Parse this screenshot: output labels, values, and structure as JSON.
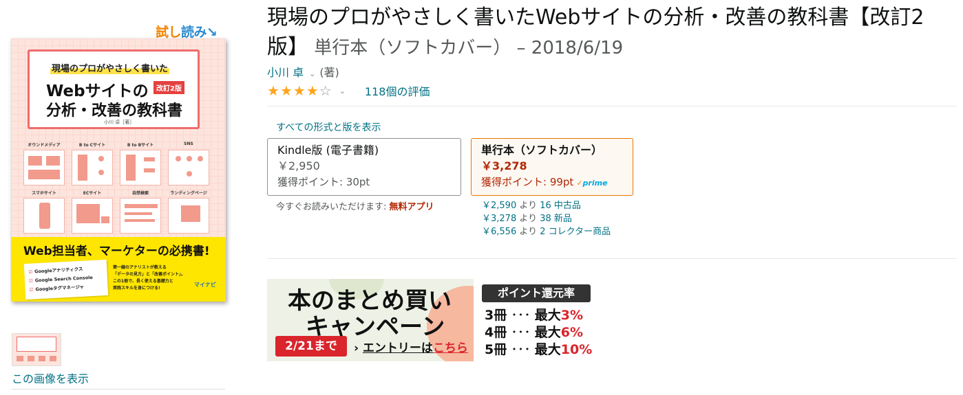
{
  "left": {
    "look_inside_a": "試し",
    "look_inside_b": "読み↘",
    "cover": {
      "line1": "現場のプロがやさしく書いた",
      "line2": "Webサイトの",
      "badge": "改訂2版",
      "line3": "分析・改善の教科書",
      "author": "小川 卓［著］",
      "tiles": [
        "オウンドメディア",
        "B to Cサイト",
        "B to Bサイト",
        "SNS",
        "スマホサイト",
        "ECサイト",
        "自然検索",
        "ランディングページ"
      ],
      "banner_title": "Web担当者、マーケターの必携書!",
      "checklist": [
        "Googleアナリティクス",
        "Google Search Console",
        "Googleタグマネージャ"
      ],
      "desc": [
        "第一線のアナリストが教える",
        "「データの見方」と「改善ポイント」。",
        "この1冊で、長く使える基礎力と",
        "実践スキルを身につける!"
      ],
      "publisher": "マイナビ"
    },
    "view_image": "この画像を表示"
  },
  "product": {
    "title": "現場のプロがやさしく書いたWebサイトの分析・改善の教科書【改訂2版】",
    "subtitle": " 単行本（ソフトカバー） – 2018/6/19",
    "author": "小川 卓",
    "author_chevron": "⌄",
    "role": "(著)",
    "rating_value": 4.0,
    "stars": [
      "★",
      "★",
      "★",
      "★",
      "☆"
    ],
    "rating_chevron": "⌄",
    "review_count": "118個の評価"
  },
  "formats": {
    "all_formats": "すべての形式と版を表示",
    "kindle": {
      "name": "Kindle版 (電子書籍)",
      "price": "￥2,950",
      "points": "獲得ポイント: 30pt"
    },
    "paperback": {
      "name": "単行本（ソフトカバー）",
      "price": "￥3,278",
      "points": "獲得ポイント: 99pt",
      "prime": "prime"
    },
    "kindle_note": "今すぐお読みいただけます: ",
    "kindle_note_link": "無料アプリ",
    "offers": [
      {
        "price": "￥2,590",
        "yori": "より",
        "count": "16 中古品"
      },
      {
        "price": "￥3,278",
        "yori": "より",
        "count": "38 新品"
      },
      {
        "price": "￥6,556",
        "yori": "より",
        "count": "2 コレクター商品"
      }
    ]
  },
  "promo": {
    "title1": "本のまとめ買い",
    "title2": "キャンペーン",
    "deadline": "2/21まで",
    "entry_arrow": "›",
    "entry_text": "エントリーは",
    "entry_link": "こちら",
    "rate_tag": "ポイント還元率",
    "rates": [
      {
        "label": "3冊",
        "dots": "･･･",
        "value": "最大",
        "pct": "3%"
      },
      {
        "label": "4冊",
        "dots": "･･･",
        "value": "最大",
        "pct": "6%"
      },
      {
        "label": "5冊",
        "dots": "･･･",
        "value": "最大",
        "pct": "10%"
      }
    ]
  },
  "colors": {
    "link": "#007185",
    "price": "#b12704",
    "star": "#ffa41c",
    "accent": "#e77600"
  }
}
